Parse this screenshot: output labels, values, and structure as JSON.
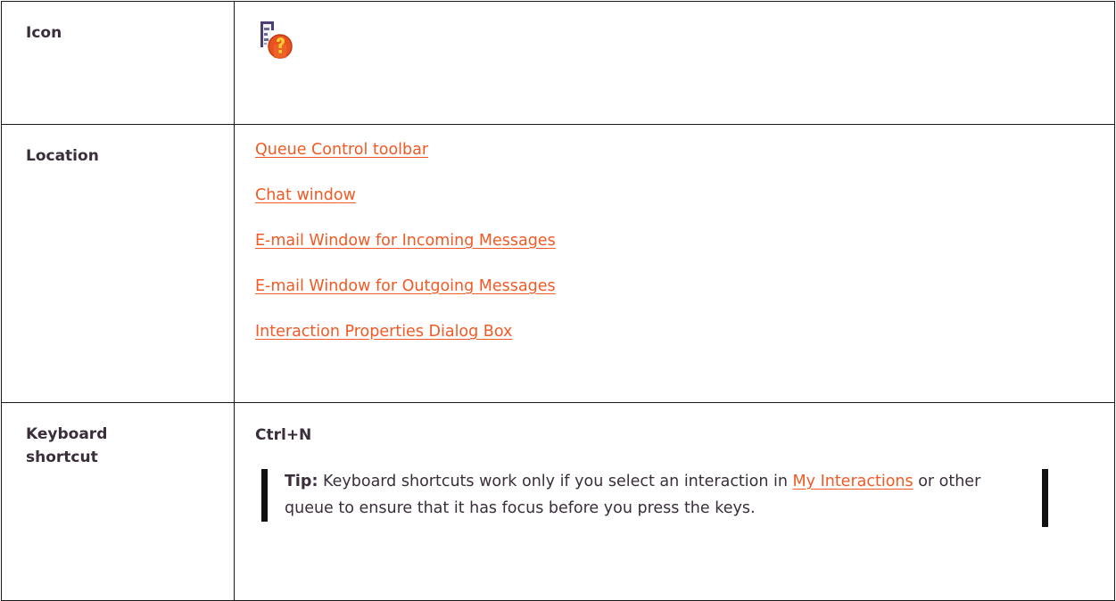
{
  "rows": {
    "icon": {
      "label": "Icon",
      "icon_name": "help-question-icon"
    },
    "location": {
      "label": "Location",
      "links": [
        "Queue Control toolbar",
        "Chat window",
        "E-mail Window for Incoming Messages",
        "E-mail Window for Outgoing Messages",
        "Interaction Properties Dialog Box"
      ]
    },
    "keyboard": {
      "label_line1": "Keyboard",
      "label_line2": "shortcut",
      "shortcut": "Ctrl+N",
      "tip": {
        "label": "Tip:",
        "text_before": " Keyboard shortcuts work only if you select an interaction in ",
        "link": "My Interactions",
        "text_after": " or other queue to ensure that it has focus before you press the keys."
      }
    }
  },
  "colors": {
    "link": "#f15a24",
    "text": "#3a2e3a",
    "border": "#1a1a1a"
  }
}
